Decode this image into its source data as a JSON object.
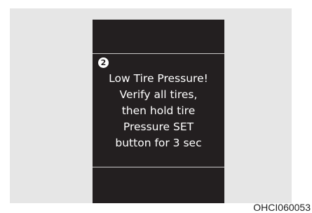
{
  "display": {
    "step_number": "2",
    "message_lines": [
      "Low Tire Pressure!",
      "Verify all tires,",
      "then hold tire",
      "Pressure SET",
      "button for 3 sec"
    ]
  },
  "figure_code": "OHCI060053"
}
